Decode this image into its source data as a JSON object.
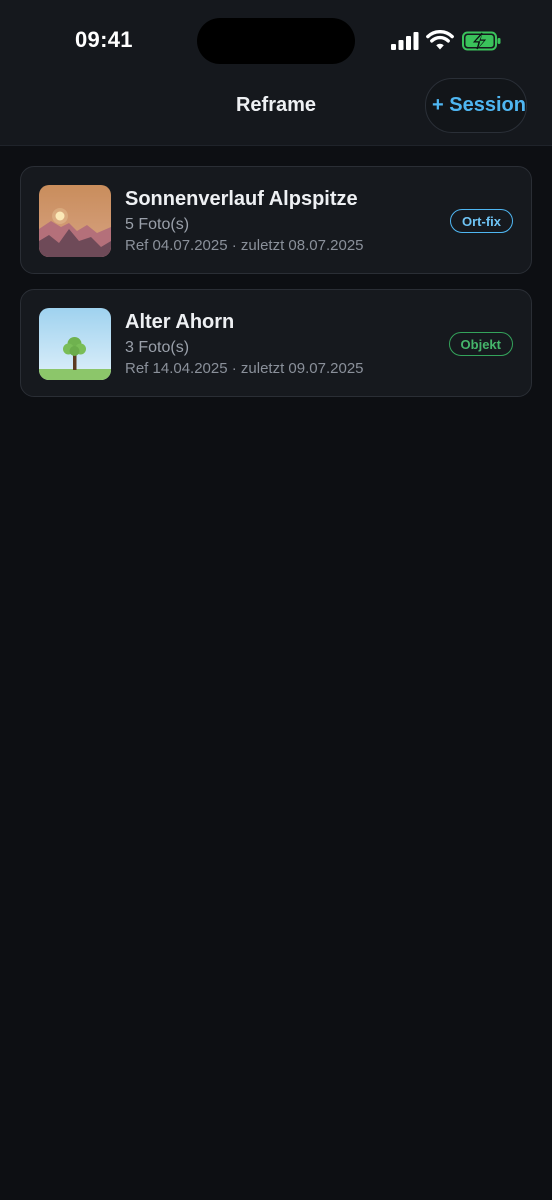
{
  "status_bar": {
    "time": "09:41"
  },
  "nav": {
    "title": "Reframe",
    "add_session_label": "+ Session"
  },
  "sessions": [
    {
      "title": "Sonnenverlauf Alpspitze",
      "count": "5 Foto(s)",
      "meta": "Ref 04.07.2025 · zuletzt 08.07.2025",
      "badge": "Ort-fix",
      "badge_color": "#4fb6f2"
    },
    {
      "title": "Alter Ahorn",
      "count": "3 Foto(s)",
      "meta": "Ref 14.04.2025 · zuletzt 09.07.2025",
      "badge": "Objekt",
      "badge_color": "#34a35b"
    }
  ],
  "colors": {
    "background": "#0d0f13",
    "accent": "#4fb6f2",
    "battery": "#3ac25b"
  }
}
